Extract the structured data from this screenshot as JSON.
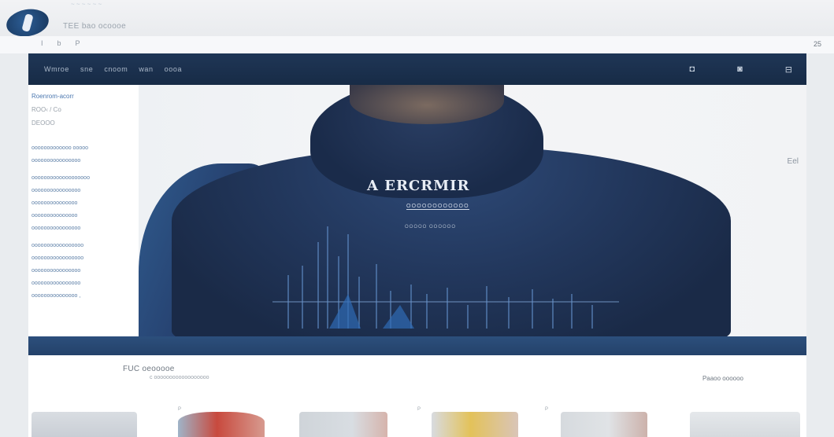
{
  "browser": {
    "tab_title": "TEE bao ocoooe",
    "tab_subtitle": "~ ~ ~ ~ ~ ~",
    "nav_glyphs": [
      "I",
      "b",
      "P"
    ],
    "zoom": "25"
  },
  "header": {
    "nav_links": [
      "Wmroe",
      "sne",
      "cnoom",
      "wan",
      "oooa"
    ],
    "icons": [
      "search-icon",
      "user-icon",
      "cart-icon"
    ],
    "icon_glyphs": [
      "◘",
      "◙",
      "⊟"
    ]
  },
  "sidebar": {
    "breadcrumb": "Roenrom-acorr",
    "filter_title": "ROO‹ / Co",
    "filter_sub": "DEOOO",
    "items": [
      "ooooooooooooo ooooo",
      "oooooooooooooooo",
      "ooooooooooooooooooo",
      "oooooooooooooooo",
      "ooooooooooooooo",
      "ooooooooooooooo",
      "oooooooooooooooo",
      "ooooooooooooooooo",
      "ooooooooooooooooo",
      "oooooooooooooooo",
      "oooooooooooooooo",
      "ooooooooooooooo ,"
    ]
  },
  "hero": {
    "title": "A ERCRMIR",
    "sub1": "OOOOOOOOOOOO",
    "sub2": "OOOOO OOOOOO",
    "side_tag": "Eel"
  },
  "section": {
    "title": "FUC oeooooe   ",
    "subtitle": "c oooooooooooooooooo",
    "link": "Paaoo  oooooo"
  },
  "products": [
    {
      "label": "",
      "color_top": "#d9dde2",
      "color_bottom": "#c9ced5"
    },
    {
      "label": "P",
      "color_top": "#c84a3e",
      "color_bottom": "#c9a6a0"
    },
    {
      "label": "",
      "color_top": "#cfd4d9",
      "color_bottom": "#d6b4ac"
    },
    {
      "label": "P",
      "color_top": "#e3c25a",
      "color_bottom": "#d9c5b8"
    },
    {
      "label": "P",
      "color_top": "#d6dade",
      "color_bottom": "#ccb2ab"
    },
    {
      "label": "",
      "color_top": "#e5e8eb",
      "color_bottom": "#d6dade"
    }
  ],
  "colors": {
    "header_bg": "#1c3050",
    "accent": "#2c4f7c",
    "hoodie": "#22375c"
  }
}
